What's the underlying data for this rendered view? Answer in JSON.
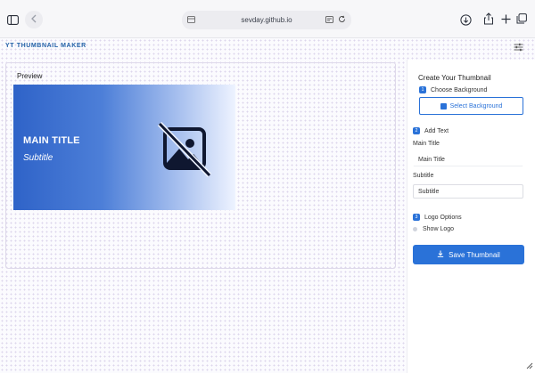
{
  "browser": {
    "url": "sevday.github.io",
    "icons": [
      "sidebar-icon",
      "back-icon",
      "page-icon",
      "translate-icon",
      "reload-icon",
      "download-icon",
      "share-icon",
      "new-tab-icon",
      "tabs-icon"
    ]
  },
  "app": {
    "brand": "YT THUMBNAIL MAKER",
    "settings_icon": "sliders-icon"
  },
  "preview": {
    "label": "Preview",
    "thumbnail": {
      "title": "MAIN TITLE",
      "subtitle": "Subtitle",
      "placeholder_icon": "image-off-icon",
      "gradient": [
        "#2f63c8",
        "#eef3ff"
      ]
    }
  },
  "panel": {
    "title": "Create Your Thumbnail",
    "step1": {
      "num": "1",
      "label": "Choose Background",
      "button": "Select Background"
    },
    "step2": {
      "num": "2",
      "label": "Add Text",
      "main_title_label": "Main Title",
      "main_title_value": "Main Title",
      "subtitle_label": "Subtitle",
      "subtitle_value": "Subtitle"
    },
    "step3": {
      "num": "3",
      "label": "Logo Options",
      "show_logo": "Show Logo"
    },
    "save_button": "Save Thumbnail"
  },
  "colors": {
    "accent": "#2a72d8",
    "brand": "#2563a8"
  }
}
